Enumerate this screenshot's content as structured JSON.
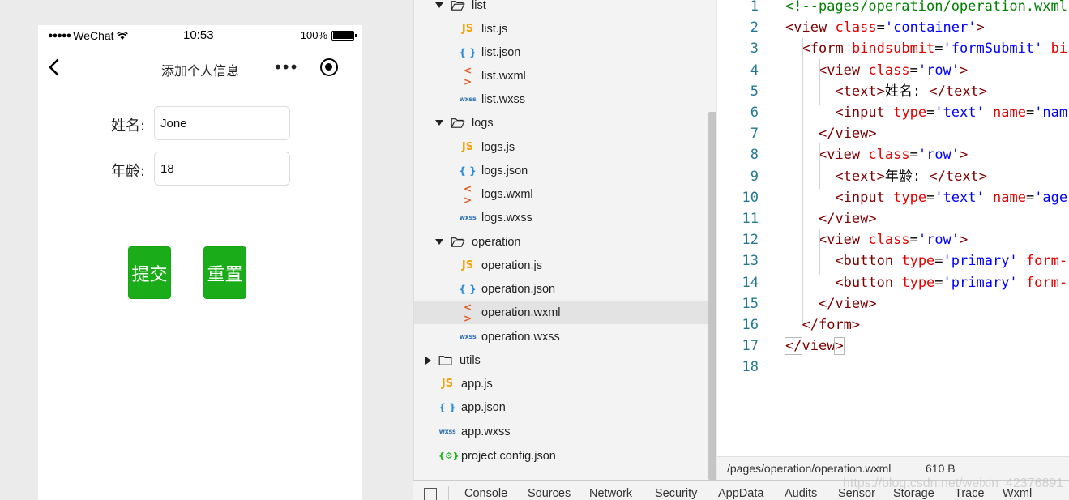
{
  "simulator": {
    "status_bar": {
      "signal": "●●●●●",
      "carrier": "WeChat",
      "time": "10:53",
      "battery_percent": "100%",
      "battery_level": 1.0
    },
    "nav_bar": {
      "title": "添加个人信息",
      "more_icon": "•••"
    },
    "form": {
      "name_label": "姓名:",
      "name_value": "Jone",
      "age_label": "年龄:",
      "age_value": "18",
      "submit_label": "提交",
      "reset_label": "重置"
    }
  },
  "file_tree": {
    "items": [
      {
        "type": "folder",
        "expanded": true,
        "label": "list",
        "icon": "folder-open-icon"
      },
      {
        "type": "file",
        "label": "list.js",
        "icon_text": "JS",
        "kind": "js"
      },
      {
        "type": "file",
        "label": "list.json",
        "icon_text": "{ }",
        "kind": "json"
      },
      {
        "type": "file",
        "label": "list.wxml",
        "icon_text": "< >",
        "kind": "wxml"
      },
      {
        "type": "file",
        "label": "list.wxss",
        "icon_text": "wxss",
        "kind": "wxss"
      },
      {
        "type": "folder",
        "expanded": true,
        "label": "logs",
        "icon": "folder-open-icon"
      },
      {
        "type": "file",
        "label": "logs.js",
        "icon_text": "JS",
        "kind": "js"
      },
      {
        "type": "file",
        "label": "logs.json",
        "icon_text": "{ }",
        "kind": "json"
      },
      {
        "type": "file",
        "label": "logs.wxml",
        "icon_text": "< >",
        "kind": "wxml"
      },
      {
        "type": "file",
        "label": "logs.wxss",
        "icon_text": "wxss",
        "kind": "wxss"
      },
      {
        "type": "folder",
        "expanded": true,
        "label": "operation",
        "icon": "folder-open-icon"
      },
      {
        "type": "file",
        "label": "operation.js",
        "icon_text": "JS",
        "kind": "js"
      },
      {
        "type": "file",
        "label": "operation.json",
        "icon_text": "{ }",
        "kind": "json"
      },
      {
        "type": "file",
        "label": "operation.wxml",
        "icon_text": "< >",
        "kind": "wxml",
        "selected": true
      },
      {
        "type": "file",
        "label": "operation.wxss",
        "icon_text": "wxss",
        "kind": "wxss"
      },
      {
        "type": "folder",
        "expanded": false,
        "label": "utils",
        "icon": "folder-closed-icon"
      },
      {
        "type": "file",
        "label": "app.js",
        "icon_text": "JS",
        "kind": "js"
      },
      {
        "type": "file",
        "label": "app.json",
        "icon_text": "{ }",
        "kind": "json"
      },
      {
        "type": "file",
        "label": "app.wxss",
        "icon_text": "wxss",
        "kind": "wxss"
      },
      {
        "type": "file",
        "label": "project.config.json",
        "icon_text": "{⚙}",
        "kind": "config"
      }
    ]
  },
  "editor": {
    "lines": [
      {
        "n": "1",
        "tokens": [
          [
            "tk-comment",
            "<!--pages/operation/operation.wxml"
          ]
        ]
      },
      {
        "n": "2",
        "tokens": [
          [
            "tk-punc",
            "<"
          ],
          [
            "tk-tag",
            "view"
          ],
          [
            "tk-text",
            " "
          ],
          [
            "tk-attr",
            "class"
          ],
          [
            "tk-text",
            "="
          ],
          [
            "tk-str",
            "'container'"
          ],
          [
            "tk-punc",
            ">"
          ]
        ]
      },
      {
        "n": "3",
        "tokens": [
          [
            "tk-text",
            "  "
          ],
          [
            "tk-punc",
            "<"
          ],
          [
            "tk-tag",
            "form"
          ],
          [
            "tk-text",
            " "
          ],
          [
            "tk-attr",
            "bindsubmit"
          ],
          [
            "tk-text",
            "="
          ],
          [
            "tk-str",
            "'formSubmit'"
          ],
          [
            "tk-text",
            " "
          ],
          [
            "tk-attr",
            "bi"
          ]
        ]
      },
      {
        "n": "4",
        "tokens": [
          [
            "tk-text",
            "    "
          ],
          [
            "tk-punc",
            "<"
          ],
          [
            "tk-tag",
            "view"
          ],
          [
            "tk-text",
            " "
          ],
          [
            "tk-attr",
            "class"
          ],
          [
            "tk-text",
            "="
          ],
          [
            "tk-str",
            "'row'"
          ],
          [
            "tk-punc",
            ">"
          ]
        ]
      },
      {
        "n": "5",
        "tokens": [
          [
            "tk-text",
            "      "
          ],
          [
            "tk-punc",
            "<"
          ],
          [
            "tk-tag",
            "text"
          ],
          [
            "tk-punc",
            ">"
          ],
          [
            "tk-text",
            "姓名: "
          ],
          [
            "tk-punc",
            "</"
          ],
          [
            "tk-tag",
            "text"
          ],
          [
            "tk-punc",
            ">"
          ]
        ]
      },
      {
        "n": "6",
        "tokens": [
          [
            "tk-text",
            "      "
          ],
          [
            "tk-punc",
            "<"
          ],
          [
            "tk-tag",
            "input"
          ],
          [
            "tk-text",
            " "
          ],
          [
            "tk-attr",
            "type"
          ],
          [
            "tk-text",
            "="
          ],
          [
            "tk-str",
            "'text'"
          ],
          [
            "tk-text",
            " "
          ],
          [
            "tk-attr",
            "name"
          ],
          [
            "tk-text",
            "="
          ],
          [
            "tk-str",
            "'nam"
          ]
        ]
      },
      {
        "n": "7",
        "tokens": [
          [
            "tk-text",
            "    "
          ],
          [
            "tk-punc",
            "</"
          ],
          [
            "tk-tag",
            "view"
          ],
          [
            "tk-punc",
            ">"
          ]
        ]
      },
      {
        "n": "8",
        "tokens": [
          [
            "tk-text",
            "    "
          ],
          [
            "tk-punc",
            "<"
          ],
          [
            "tk-tag",
            "view"
          ],
          [
            "tk-text",
            " "
          ],
          [
            "tk-attr",
            "class"
          ],
          [
            "tk-text",
            "="
          ],
          [
            "tk-str",
            "'row'"
          ],
          [
            "tk-punc",
            ">"
          ]
        ]
      },
      {
        "n": "9",
        "tokens": [
          [
            "tk-text",
            "      "
          ],
          [
            "tk-punc",
            "<"
          ],
          [
            "tk-tag",
            "text"
          ],
          [
            "tk-punc",
            ">"
          ],
          [
            "tk-text",
            "年龄: "
          ],
          [
            "tk-punc",
            "</"
          ],
          [
            "tk-tag",
            "text"
          ],
          [
            "tk-punc",
            ">"
          ]
        ]
      },
      {
        "n": "10",
        "tokens": [
          [
            "tk-text",
            "      "
          ],
          [
            "tk-punc",
            "<"
          ],
          [
            "tk-tag",
            "input"
          ],
          [
            "tk-text",
            " "
          ],
          [
            "tk-attr",
            "type"
          ],
          [
            "tk-text",
            "="
          ],
          [
            "tk-str",
            "'text'"
          ],
          [
            "tk-text",
            " "
          ],
          [
            "tk-attr",
            "name"
          ],
          [
            "tk-text",
            "="
          ],
          [
            "tk-str",
            "'age"
          ]
        ]
      },
      {
        "n": "11",
        "tokens": [
          [
            "tk-text",
            "    "
          ],
          [
            "tk-punc",
            "</"
          ],
          [
            "tk-tag",
            "view"
          ],
          [
            "tk-punc",
            ">"
          ]
        ]
      },
      {
        "n": "12",
        "tokens": [
          [
            "tk-text",
            "    "
          ],
          [
            "tk-punc",
            "<"
          ],
          [
            "tk-tag",
            "view"
          ],
          [
            "tk-text",
            " "
          ],
          [
            "tk-attr",
            "class"
          ],
          [
            "tk-text",
            "="
          ],
          [
            "tk-str",
            "'row'"
          ],
          [
            "tk-punc",
            ">"
          ]
        ]
      },
      {
        "n": "13",
        "tokens": [
          [
            "tk-text",
            "      "
          ],
          [
            "tk-punc",
            "<"
          ],
          [
            "tk-tag",
            "button"
          ],
          [
            "tk-text",
            " "
          ],
          [
            "tk-attr",
            "type"
          ],
          [
            "tk-text",
            "="
          ],
          [
            "tk-str",
            "'primary'"
          ],
          [
            "tk-text",
            " "
          ],
          [
            "tk-attr",
            "form-"
          ]
        ]
      },
      {
        "n": "14",
        "tokens": [
          [
            "tk-text",
            "      "
          ],
          [
            "tk-punc",
            "<"
          ],
          [
            "tk-tag",
            "button"
          ],
          [
            "tk-text",
            " "
          ],
          [
            "tk-attr",
            "type"
          ],
          [
            "tk-text",
            "="
          ],
          [
            "tk-str",
            "'primary'"
          ],
          [
            "tk-text",
            " "
          ],
          [
            "tk-attr",
            "form-"
          ]
        ]
      },
      {
        "n": "15",
        "tokens": [
          [
            "tk-text",
            "    "
          ],
          [
            "tk-punc",
            "</"
          ],
          [
            "tk-tag",
            "view"
          ],
          [
            "tk-punc",
            ">"
          ]
        ]
      },
      {
        "n": "16",
        "tokens": [
          [
            "tk-text",
            "  "
          ],
          [
            "tk-punc",
            "</"
          ],
          [
            "tk-tag",
            "form"
          ],
          [
            "tk-punc",
            ">"
          ]
        ]
      },
      {
        "n": "17",
        "tokens": [
          [
            "tk-punc",
            "</"
          ],
          [
            "tk-tag",
            "view"
          ],
          [
            "tk-punc",
            ">"
          ]
        ]
      },
      {
        "n": "18",
        "tokens": []
      }
    ],
    "status": {
      "path": "/pages/operation/operation.wxml",
      "size": "610 B"
    }
  },
  "devtools": {
    "tabs": [
      "Console",
      "Sources",
      "Network",
      "Security",
      "AppData",
      "Audits",
      "Sensor",
      "Storage",
      "Trace",
      "Wxml"
    ]
  },
  "watermark": "https://blog.csdn.net/weixin_42376891",
  "colors": {
    "primary_button": "#1aad19",
    "selected_row": "#e3e3e3"
  }
}
